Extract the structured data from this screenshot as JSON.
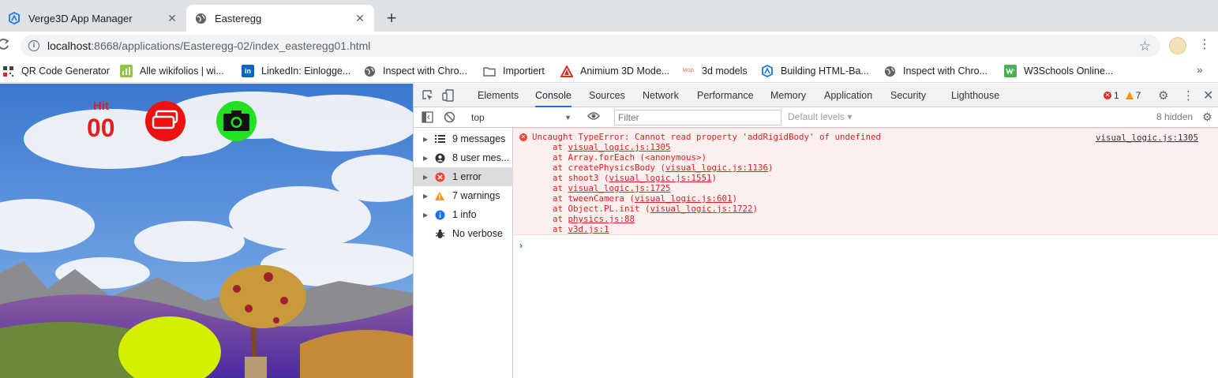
{
  "tabs": [
    {
      "title": "Verge3D App Manager",
      "favicon": "verge3d-icon",
      "close": "✕"
    },
    {
      "title": "Easteregg",
      "favicon": "globe-icon",
      "close": "✕"
    }
  ],
  "new_tab": "+",
  "address": {
    "host": "localhost",
    "rest": ":8668/applications/Easteregg-02/index_easteregg01.html"
  },
  "bookmarks": [
    {
      "label": "QR Code Generator",
      "icon": "qr-icon",
      "color": "#444444"
    },
    {
      "label": "Alle wikifolios | wi...",
      "icon": "chart-icon",
      "color": "#8dc63f"
    },
    {
      "label": "LinkedIn: Einlogge...",
      "icon": "linkedin-icon",
      "color": "#0a66c2",
      "glyph": "in"
    },
    {
      "label": "Inspect with Chro...",
      "icon": "globe-icon",
      "color": "#5f6368"
    },
    {
      "label": "Importiert",
      "icon": "folder-icon",
      "color": "#5f6368"
    },
    {
      "label": "Animium 3D Mode...",
      "icon": "animium-icon",
      "color": "#d93025"
    },
    {
      "label": "3d models",
      "icon": "mod-icon",
      "color": "#f28b82",
      "glyph": "MOD"
    },
    {
      "label": "Building HTML-Ba...",
      "icon": "verge3d-icon",
      "color": "#1a73e8"
    },
    {
      "label": "Inspect with Chro...",
      "icon": "globe-icon",
      "color": "#5f6368"
    },
    {
      "label": "W3Schools Online...",
      "icon": "w3schools-icon",
      "color": "#4caf50"
    }
  ],
  "bookmarks_more": "»",
  "scene": {
    "hit_label": "Hit",
    "hit_count": "00"
  },
  "devtools": {
    "tabs": [
      "Elements",
      "Console",
      "Sources",
      "Network",
      "Performance",
      "Memory",
      "Application",
      "Security",
      "Lighthouse"
    ],
    "active_tab": "Console",
    "error_count": "1",
    "warning_count": "7",
    "context": "top",
    "filter_placeholder": "Filter",
    "levels": "Default levels ▾",
    "hidden": "8 hidden",
    "sidebar": [
      {
        "label": "9 messages",
        "icon": "list-icon"
      },
      {
        "label": "8 user mes...",
        "icon": "user-icon"
      },
      {
        "label": "1 error",
        "icon": "error-icon"
      },
      {
        "label": "7 warnings",
        "icon": "warning-icon"
      },
      {
        "label": "1 info",
        "icon": "info-icon"
      },
      {
        "label": "No verbose",
        "icon": "bug-icon"
      }
    ],
    "error": {
      "message": "Uncaught TypeError: Cannot read property 'addRigidBody' of undefined",
      "source": "visual_logic.js:1305",
      "stack": [
        {
          "pre": "    at ",
          "link": "visual_logic.js:1305",
          "post": ""
        },
        {
          "pre": "    at Array.forEach (<anonymous>)",
          "link": "",
          "post": ""
        },
        {
          "pre": "    at createPhysicsBody (",
          "link": "visual_logic.js:1136",
          "post": ")"
        },
        {
          "pre": "    at shoot3 (",
          "link": "visual_logic.js:1551",
          "post": ")"
        },
        {
          "pre": "    at ",
          "link": "visual_logic.js:1725",
          "post": ""
        },
        {
          "pre": "    at tweenCamera (",
          "link": "visual_logic.js:601",
          "post": ")"
        },
        {
          "pre": "    at Object.PL.init (",
          "link": "visual_logic.js:1722",
          "post": ")"
        },
        {
          "pre": "    at ",
          "link": "physics.js:88",
          "post": ""
        },
        {
          "pre": "    at ",
          "link": "v3d.js:1",
          "post": ""
        }
      ]
    },
    "prompt": "›"
  },
  "colors": {
    "accent": "#1a73e8",
    "error": "#e41e1e",
    "error_bg": "#fff0f0",
    "hit": "#e41e1e"
  }
}
